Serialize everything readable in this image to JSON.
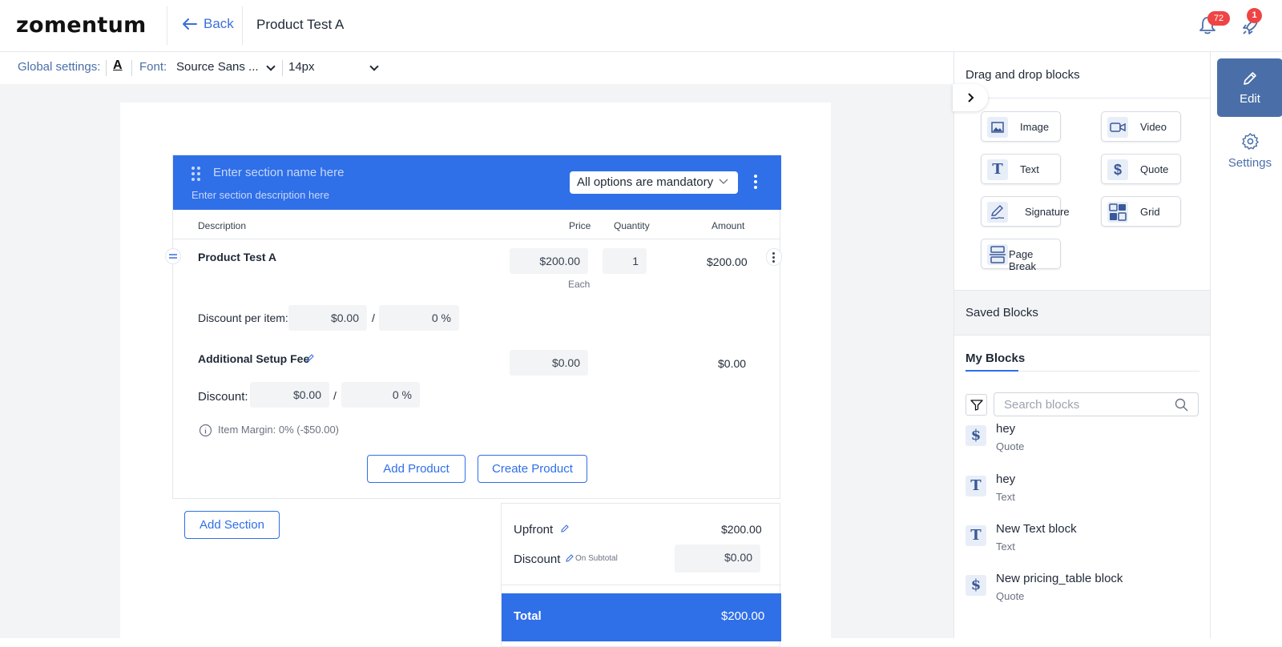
{
  "header": {
    "logo": "zomentum",
    "back_label": "Back",
    "title": "Product Test A",
    "notifications_count": "72",
    "rocket_count": "1"
  },
  "global_settings": {
    "label": "Global settings:",
    "text_color_glyph": "A",
    "font_label": "Font:",
    "font_value": "Source Sans ...",
    "size_value": "14px"
  },
  "section": {
    "name_placeholder": "Enter section name here",
    "description_placeholder": "Enter section description here",
    "options_select": "All options are mandatory",
    "columns": {
      "description": "Description",
      "price": "Price",
      "quantity": "Quantity",
      "amount": "Amount"
    },
    "product": {
      "name": "Product Test A",
      "price": "$200.00",
      "price_unit": "Each",
      "quantity": "1",
      "amount": "$200.00",
      "discount_label": "Discount per item:",
      "discount_value": "$0.00",
      "discount_sep": "/",
      "discount_percent": "0 %"
    },
    "setup_fee": {
      "name": "Additional Setup Fee",
      "price": "$0.00",
      "amount": "$0.00",
      "discount_label": "Discount:",
      "discount_value": "$0.00",
      "discount_sep": "/",
      "discount_percent": "0 %"
    },
    "margin_text": "Item Margin: 0% (-$50.00)",
    "add_product": "Add Product",
    "create_product": "Create Product"
  },
  "add_section": "Add Section",
  "totals": {
    "upfront_label": "Upfront",
    "upfront_value": "$200.00",
    "discount_label": "Discount",
    "discount_note": "On Subtotal",
    "discount_value": "$0.00",
    "total_label": "Total",
    "total_value": "$200.00"
  },
  "right_panel": {
    "title": "Drag and drop blocks",
    "blocks": [
      {
        "label": "Image",
        "icon": "image-icon"
      },
      {
        "label": "Video",
        "icon": "video-icon"
      },
      {
        "label": "Text",
        "icon": "text-icon"
      },
      {
        "label": "Quote",
        "icon": "dollar-icon"
      },
      {
        "label": "Signature",
        "icon": "signature-icon"
      },
      {
        "label": "Grid",
        "icon": "grid-icon"
      },
      {
        "label": "Page Break",
        "icon": "page-break-icon"
      }
    ],
    "saved_blocks": "Saved Blocks",
    "my_blocks": "My Blocks",
    "search_placeholder": "Search blocks",
    "items": [
      {
        "name": "hey",
        "type": "Quote",
        "glyph": "$"
      },
      {
        "name": "hey",
        "type": "Text",
        "glyph": "T"
      },
      {
        "name": "New Text block",
        "type": "Text",
        "glyph": "T"
      },
      {
        "name": "New pricing_table block",
        "type": "Quote",
        "glyph": "$"
      }
    ]
  },
  "rail": {
    "edit": "Edit",
    "settings": "Settings"
  },
  "colors": {
    "accent": "#2f6fe8",
    "rail_active": "#4a6fa8",
    "badge": "#ef4444"
  }
}
